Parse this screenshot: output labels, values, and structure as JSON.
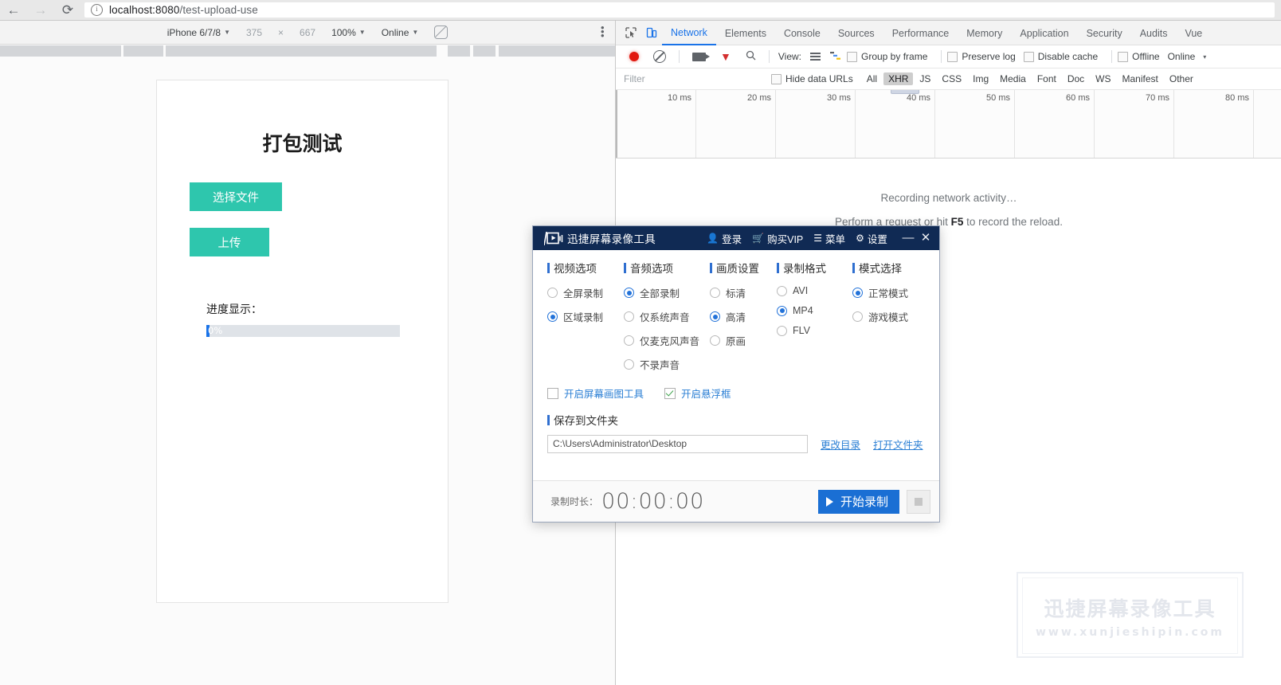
{
  "browser": {
    "back_icon": "←",
    "forward_icon": "→",
    "reload_icon": "⟳",
    "url_host": "localhost:8080",
    "url_path": "/test-upload-use",
    "security_icon": "info-icon"
  },
  "device_toolbar": {
    "device": "iPhone 6/7/8",
    "width": "375",
    "times": "×",
    "height": "667",
    "zoom": "100%",
    "throttle": "Online",
    "rotate_icon": "rotate-icon",
    "more_icon": "kebab-menu-icon"
  },
  "page": {
    "title": "打包测试",
    "choose_file": "选择文件",
    "upload": "上传",
    "progress_label": "进度显示：",
    "progress_value": "0%",
    "progress_percent": 0
  },
  "devtools": {
    "inspect_icon": "inspect-element-icon",
    "device_icon": "toggle-device-toolbar-icon",
    "tabs": [
      "Network",
      "Elements",
      "Console",
      "Sources",
      "Performance",
      "Memory",
      "Application",
      "Security",
      "Audits",
      "Vue"
    ],
    "selected_tab": "Network",
    "toolbar": {
      "record_icon": "record-icon",
      "clear_icon": "clear-icon",
      "screenshot_icon": "camera-icon",
      "filter_icon": "filter-funnel-icon",
      "search_icon": "search-icon",
      "view_label": "View:",
      "list_view_icon": "list-view-icon",
      "waterfall_view_icon": "waterfall-view-icon",
      "group_by_frame": "Group by frame",
      "preserve_log": "Preserve log",
      "disable_cache": "Disable cache",
      "offline": "Offline",
      "throttle_value": "Online",
      "throttle_caret": "▾"
    },
    "filter_bar": {
      "filter_placeholder": "Filter",
      "hide_data_urls": "Hide data URLs",
      "types": [
        "All",
        "XHR",
        "JS",
        "CSS",
        "Img",
        "Media",
        "Font",
        "Doc",
        "WS",
        "Manifest",
        "Other"
      ],
      "active_type": "XHR"
    },
    "timeline": {
      "ticks": [
        "10 ms",
        "20 ms",
        "30 ms",
        "40 ms",
        "50 ms",
        "60 ms",
        "70 ms",
        "80 ms"
      ]
    },
    "empty_state_line1": "Recording network activity…",
    "empty_state_line2_pre": "Perform a request or hit ",
    "empty_state_line2_key": "F5",
    "empty_state_line2_post": " to record the reload."
  },
  "recorder": {
    "title": "迅捷屏幕录像工具",
    "logo_icon": "play-screen-logo-icon",
    "login": "登录",
    "login_icon": "user-icon",
    "buy_vip": "购买VIP",
    "buy_vip_icon": "cart-icon",
    "menu": "菜单",
    "menu_icon": "hamburger-icon",
    "settings": "设置",
    "settings_icon": "gear-icon",
    "minimize_icon": "—",
    "close_icon": "✕",
    "groups": [
      {
        "heading": "视频选项",
        "options": [
          {
            "label": "全屏录制",
            "selected": false
          },
          {
            "label": "区域录制",
            "selected": true
          }
        ]
      },
      {
        "heading": "音频选项",
        "options": [
          {
            "label": "全部录制",
            "selected": true
          },
          {
            "label": "仅系统声音",
            "selected": false
          },
          {
            "label": "仅麦克风声音",
            "selected": false
          },
          {
            "label": "不录声音",
            "selected": false
          }
        ]
      },
      {
        "heading": "画质设置",
        "options": [
          {
            "label": "标清",
            "selected": false
          },
          {
            "label": "高清",
            "selected": true
          },
          {
            "label": "原画",
            "selected": false
          }
        ]
      },
      {
        "heading": "录制格式",
        "options": [
          {
            "label": "AVI",
            "selected": false
          },
          {
            "label": "MP4",
            "selected": true
          },
          {
            "label": "FLV",
            "selected": false
          }
        ]
      },
      {
        "heading": "模式选择",
        "options": [
          {
            "label": "正常模式",
            "selected": true
          },
          {
            "label": "游戏模式",
            "selected": false
          }
        ]
      }
    ],
    "checkbox_draw_tool": "开启屏幕画图工具",
    "checkbox_draw_tool_checked": false,
    "checkbox_float_box": "开启悬浮框",
    "checkbox_float_box_checked": true,
    "save_folder_heading": "保存到文件夹",
    "save_folder_path": "C:\\Users\\Administrator\\Desktop",
    "change_dir": "更改目录",
    "open_folder": "打开文件夹",
    "duration_label": "录制时长：",
    "duration_value": "00:00:00",
    "start_button": "开始录制",
    "stop_button_icon": "stop-square-icon"
  },
  "watermark": {
    "line1": "迅捷屏幕录像工具",
    "line2": "www.xunjieshipin.com"
  },
  "colors": {
    "accent_teal": "#2ec6ad",
    "devtools_blue": "#1a73e8",
    "recorder_navy": "#102a54",
    "recorder_blue": "#1a6fd4",
    "record_red": "#e1190f"
  }
}
